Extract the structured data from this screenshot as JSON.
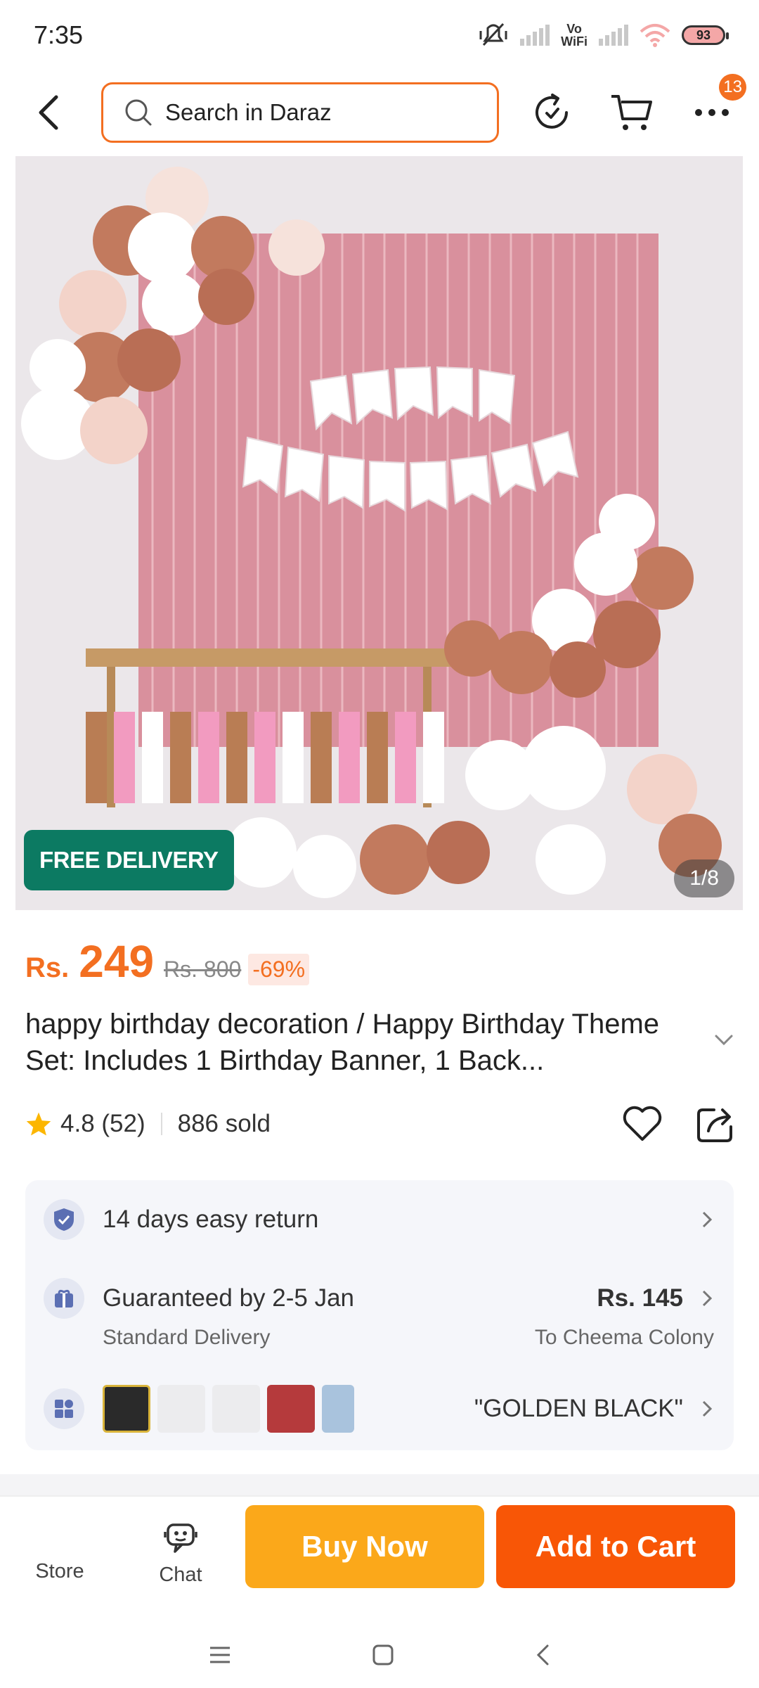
{
  "status_bar": {
    "time": "7:35",
    "vowifi": "Vo\nWiFi",
    "battery": "93"
  },
  "header": {
    "search_placeholder": "Search in Daraz",
    "cart_badge": "13"
  },
  "gallery": {
    "badge": "FREE DELIVERY",
    "counter": "1/8"
  },
  "product": {
    "currency": "Rs.",
    "price": "249",
    "original_price": "Rs. 800",
    "discount": "-69%",
    "title": "happy birthday decoration / Happy Birthday Theme Set: Includes 1 Birthday Banner, 1 Back...",
    "rating": "4.8 (52)",
    "sold": "886 sold"
  },
  "service": {
    "return_policy": "14 days easy return",
    "delivery_guarantee": "Guaranteed by 2-5 Jan",
    "delivery_type": "Standard Delivery",
    "delivery_fee": "Rs. 145",
    "delivery_location": "To Cheema Colony",
    "selected_variant": "\"GOLDEN BLACK\""
  },
  "bottom_bar": {
    "store": "Store",
    "chat": "Chat",
    "buy_now": "Buy Now",
    "add_to_cart": "Add to Cart"
  },
  "colors": {
    "accent": "#f36f21",
    "buy_now": "#fba81a",
    "add_to_cart": "#f85606",
    "free_delivery": "#0c7a62"
  }
}
